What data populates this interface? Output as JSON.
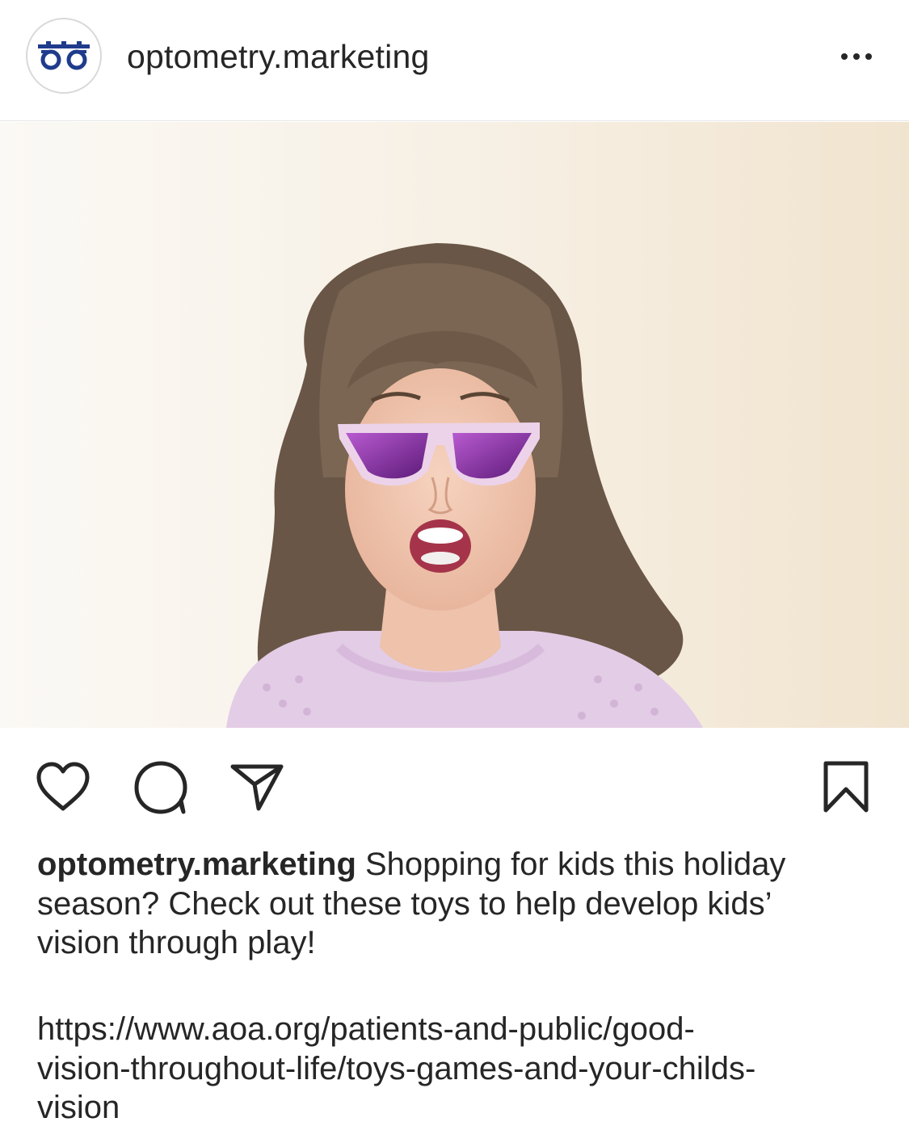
{
  "post": {
    "username": "optometry.marketing",
    "caption_username": "optometry.marketing",
    "caption_line1": " Shopping for kids this holiday",
    "caption_line2": "season? Check out these toys to help develop kids’",
    "caption_line3": "vision through play!",
    "link_line1": "https://www.aoa.org/patients-and-public/good-",
    "link_line2": "vision-throughout-life/toys-games-and-your-childs-",
    "link_line3": "vision"
  },
  "icons": {
    "more": "more-options-icon",
    "like": "heart-icon",
    "comment": "comment-icon",
    "share": "share-icon",
    "save": "bookmark-icon",
    "avatar": "glasses-logo-icon"
  },
  "colors": {
    "brand": "#1f3c8c",
    "text": "#262626",
    "background": "#ffffff",
    "sunglasses_frame": "#e9cfe6",
    "lens": "#8a2fa8",
    "shirt": "#e3cce6",
    "wall": "#f4ead9"
  }
}
